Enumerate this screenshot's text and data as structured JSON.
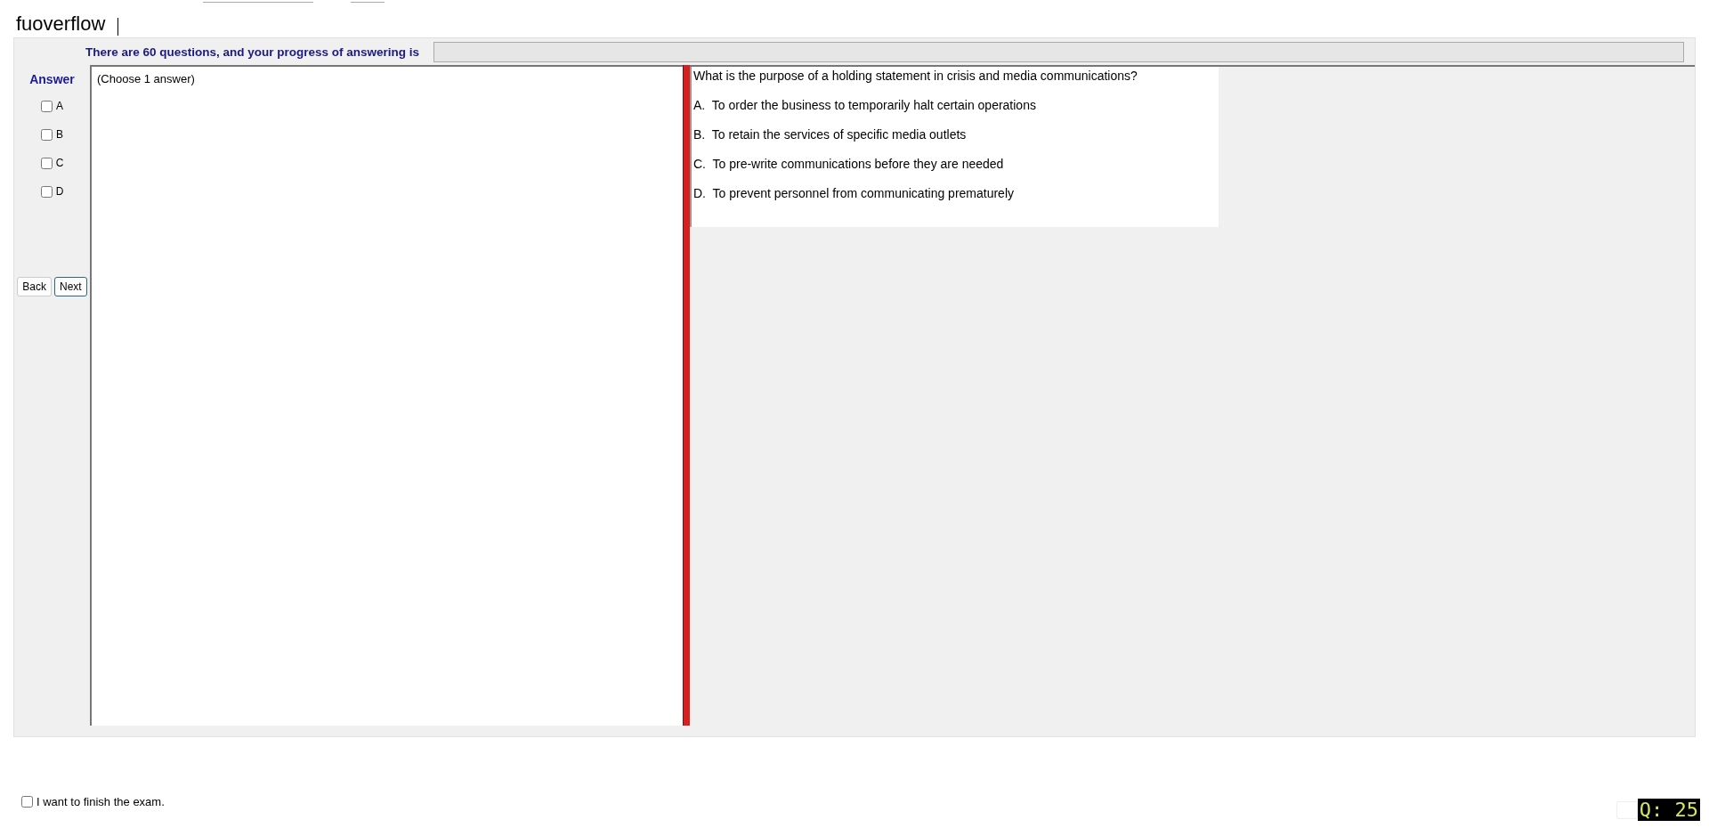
{
  "title": "fuoverflow",
  "progress": {
    "label": "There are 60 questions, and your progress of answering is",
    "level": 0
  },
  "answer_panel": {
    "heading": "Answer",
    "options": [
      {
        "label": "A",
        "checked": false
      },
      {
        "label": "B",
        "checked": false
      },
      {
        "label": "C",
        "checked": false
      },
      {
        "label": "D",
        "checked": false
      }
    ]
  },
  "buttons": [
    {
      "label": "Back",
      "selected": false
    },
    {
      "label": "Next",
      "selected": true
    }
  ],
  "instruction": "(Choose 1 answer)",
  "question": {
    "text": "What is the purpose of a holding statement in crisis and media communications?",
    "choices": [
      "A.  To order the business to temporarily halt certain operations",
      "B.  To retain the services of specific media outlets",
      "C.  To pre-write communications before they are needed",
      "D.  To prevent personnel from communicating prematurely"
    ]
  },
  "finish": {
    "label": "I want to finish the exam.",
    "checked": false
  },
  "question_number": "Q: 25"
}
